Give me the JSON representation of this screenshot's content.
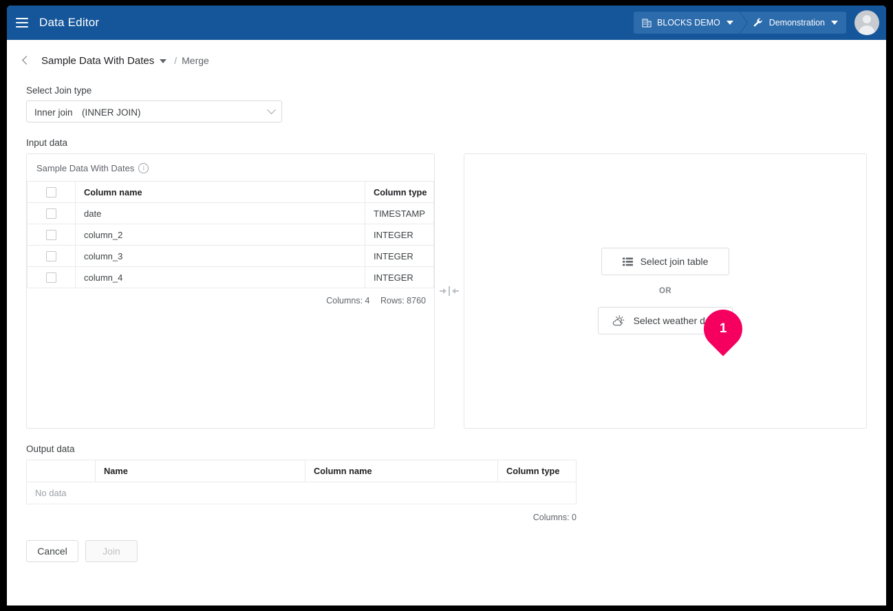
{
  "appbar": {
    "menu_icon": "hamburger-icon",
    "title": "Data Editor",
    "project_chip": {
      "icon": "building-icon",
      "label": "BLOCKS DEMO"
    },
    "app_chip": {
      "icon": "wrench-icon",
      "label": "Demonstration"
    },
    "avatar": "user-avatar-icon"
  },
  "breadcrumb": {
    "back_icon": "chevron-left-icon",
    "dataset": "Sample Data With Dates",
    "separator": "/",
    "current": "Merge"
  },
  "join_type": {
    "label": "Select Join type",
    "selected": "Inner join　(INNER JOIN)"
  },
  "input_data": {
    "label": "Input data",
    "left_panel": {
      "title": "Sample Data With Dates",
      "info_icon": "i",
      "headers": [
        "",
        "Column name",
        "Column type"
      ],
      "rows": [
        {
          "name": "date",
          "type": "TIMESTAMP"
        },
        {
          "name": "column_2",
          "type": "INTEGER"
        },
        {
          "name": "column_3",
          "type": "INTEGER"
        },
        {
          "name": "column_4",
          "type": "INTEGER"
        }
      ],
      "footer": {
        "columns": "Columns: 4",
        "rows": "Rows: 8760"
      }
    },
    "connector_icon": "join-arrows-icon",
    "right_panel": {
      "select_join_table": {
        "icon": "table-list-icon",
        "label": "Select join table"
      },
      "or": "OR",
      "select_weather_data": {
        "icon": "weather-sun-cloud-icon",
        "label": "Select weather data"
      },
      "callout": {
        "number": "1",
        "color": "#F5005E"
      }
    }
  },
  "output_data": {
    "label": "Output data",
    "headers": [
      "",
      "Name",
      "Column name",
      "Column type"
    ],
    "empty_text": "No data",
    "footer": "Columns: 0"
  },
  "actions": {
    "cancel": "Cancel",
    "join": "Join"
  },
  "theme": {
    "header_blue": "#15569A",
    "chip_blue": "#2C6BAC",
    "accent_pink": "#F5005E"
  }
}
